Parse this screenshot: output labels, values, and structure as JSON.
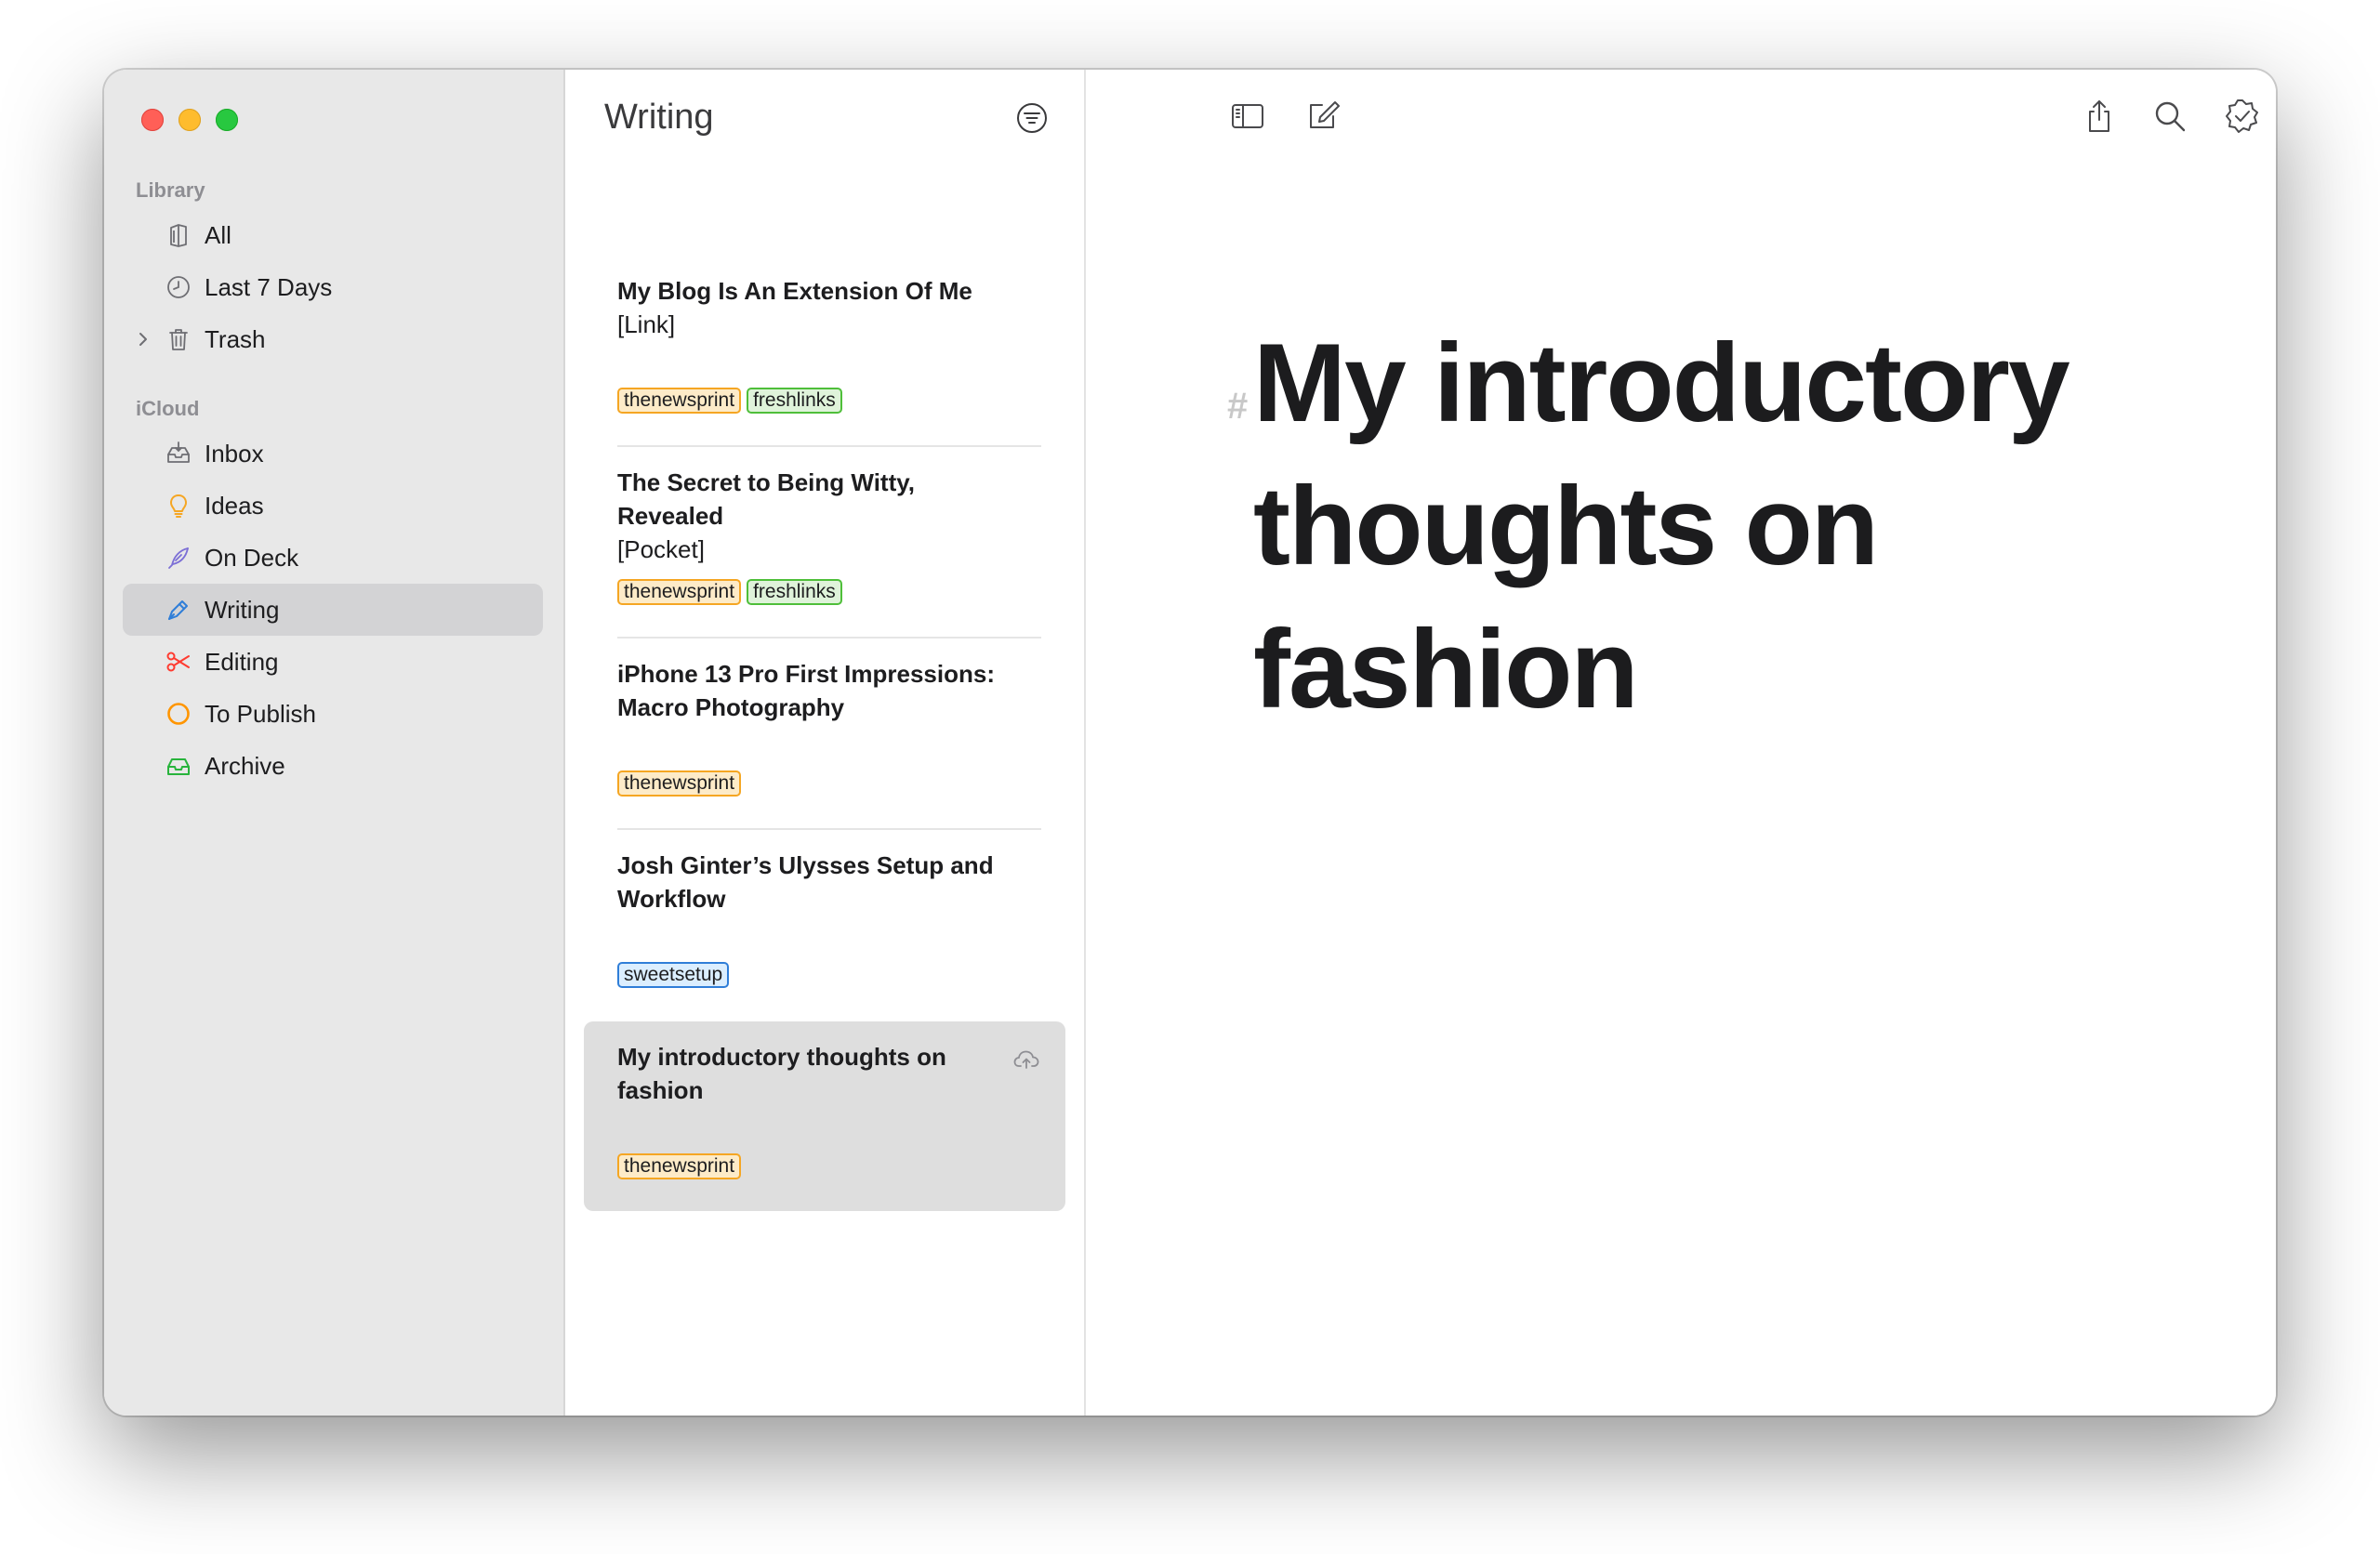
{
  "sidebar": {
    "sections": [
      {
        "title": "Library",
        "items": [
          {
            "label": "All",
            "icon": "all-notes-icon"
          },
          {
            "label": "Last 7 Days",
            "icon": "clock-icon"
          },
          {
            "label": "Trash",
            "icon": "trash-icon"
          }
        ]
      },
      {
        "title": "iCloud",
        "items": [
          {
            "label": "Inbox",
            "icon": "inbox-icon"
          },
          {
            "label": "Ideas",
            "icon": "lightbulb-icon"
          },
          {
            "label": "On Deck",
            "icon": "feather-icon"
          },
          {
            "label": "Writing",
            "icon": "pen-icon",
            "selected": true
          },
          {
            "label": "Editing",
            "icon": "scissors-icon"
          },
          {
            "label": "To Publish",
            "icon": "circle-icon"
          },
          {
            "label": "Archive",
            "icon": "archive-tray-icon"
          }
        ]
      }
    ]
  },
  "notelist": {
    "title": "Writing",
    "notes": [
      {
        "title": "My Blog Is An Extension Of Me",
        "subtitle": "[Link]",
        "tags": [
          {
            "label": "thenewsprint",
            "color": "#f5a623"
          },
          {
            "label": "freshlinks",
            "color": "#4fbf3a"
          }
        ]
      },
      {
        "title": "The Secret to Being Witty, Revealed",
        "subtitle": "[Pocket]",
        "tags": [
          {
            "label": "thenewsprint",
            "color": "#f5a623"
          },
          {
            "label": "freshlinks",
            "color": "#4fbf3a"
          }
        ]
      },
      {
        "title": "iPhone 13 Pro First Impressions: Macro Photography",
        "subtitle": "",
        "tags": [
          {
            "label": "thenewsprint",
            "color": "#f5a623"
          }
        ]
      },
      {
        "title": "Josh Ginter’s Ulysses Setup and Workflow",
        "subtitle": "",
        "tags": [
          {
            "label": "sweetsetup",
            "color": "#2f7ed8"
          }
        ]
      },
      {
        "title": "My introductory thoughts on fashion",
        "subtitle": "",
        "tags": [
          {
            "label": "thenewsprint",
            "color": "#f5a623"
          }
        ],
        "selected": true
      }
    ]
  },
  "editor": {
    "heading_marker": "#",
    "heading": "My introductory thoughts on fashion"
  },
  "colors": {
    "accent": "#2f7ed8",
    "sidebar_bg": "#e8e8e8",
    "selected_bg": "#d3d3d5"
  }
}
